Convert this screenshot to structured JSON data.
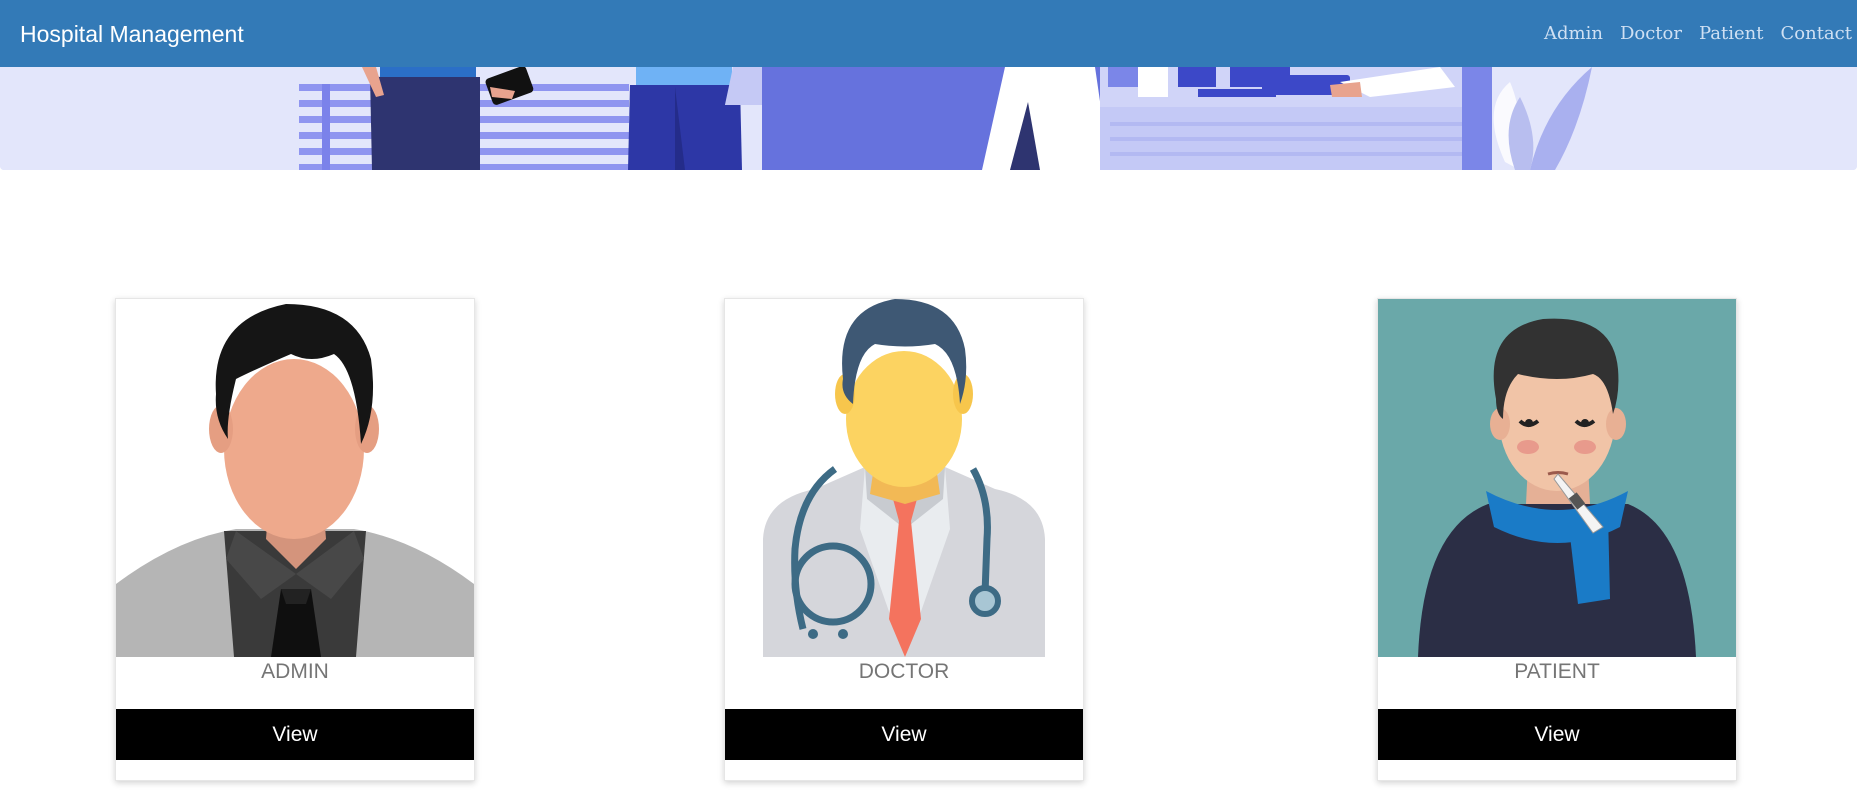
{
  "navbar": {
    "brand": "Hospital Management",
    "links": [
      "Admin",
      "Doctor",
      "Patient",
      "Contact Us"
    ]
  },
  "cards": [
    {
      "title": "ADMIN",
      "button": "View"
    },
    {
      "title": "DOCTOR",
      "button": "View"
    },
    {
      "title": "PATIENT",
      "button": "View"
    }
  ],
  "colors": {
    "navbar": "#337ab7",
    "banner_bg": "#e3e6fb",
    "button": "#000000",
    "patient_bg": "#6aa8a9"
  }
}
